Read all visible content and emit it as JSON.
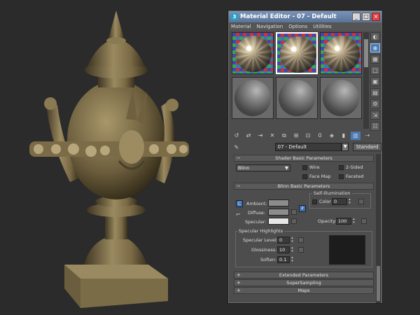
{
  "window": {
    "title": "Material Editor - 07 - Default",
    "menu": [
      "Material",
      "Navigation",
      "Options",
      "Utilities"
    ]
  },
  "toolbar": {
    "material_name": "07 - Default",
    "material_type": "Standard"
  },
  "rollouts": {
    "shader_basic": {
      "title": "Shader Basic Parameters",
      "shader": "Blinn",
      "wire": "Wire",
      "two_sided": "2-Sided",
      "face_map": "Face Map",
      "faceted": "Faceted"
    },
    "blinn_basic": {
      "title": "Blinn Basic Parameters",
      "self_illumination": "Self-Illumination",
      "color_label": "Color",
      "color_value": "0",
      "ambient": "Ambient:",
      "diffuse": "Diffuse:",
      "specular": "Specular:",
      "lock_c": "C",
      "opacity_label": "Opacity:",
      "opacity_value": "100",
      "specular_highlights": "Specular Highlights",
      "specular_level_label": "Specular Level:",
      "specular_level_value": "0",
      "glossiness_label": "Glossiness:",
      "glossiness_value": "10",
      "soften_label": "Soften:",
      "soften_value": "0.1"
    },
    "extended": "Extended Parameters",
    "supersampling": "SuperSampling",
    "maps": "Maps"
  },
  "colors": {
    "ambient": "#8c8c8c",
    "diffuse": "#8c8c8c",
    "specular": "#e6e6e6",
    "highlight_preview": "#1c1c1c",
    "urn": "#8a7a55"
  }
}
